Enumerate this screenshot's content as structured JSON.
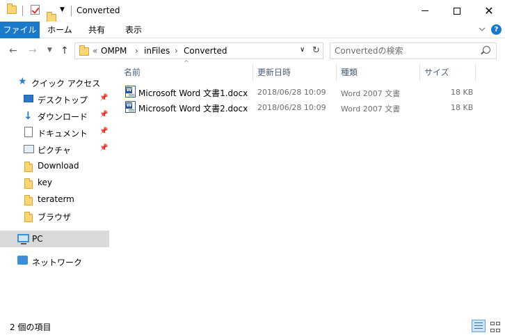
{
  "window": {
    "title": "Converted"
  },
  "ribbon": {
    "tabs": [
      "ファイル",
      "ホーム",
      "共有",
      "表示"
    ],
    "help": "?"
  },
  "address": {
    "overflow": "«",
    "crumbs": [
      "OMPM",
      "inFiles",
      "Converted"
    ],
    "separator": "›"
  },
  "search": {
    "placeholder": "Convertedの検索"
  },
  "navigation": {
    "quick_access": "クイック アクセス",
    "items": [
      {
        "label": "デスクトップ",
        "icon": "desktop-icon",
        "pinned": true
      },
      {
        "label": "ダウンロード",
        "icon": "download-arrow-icon",
        "pinned": true
      },
      {
        "label": "ドキュメント",
        "icon": "documents-icon",
        "pinned": true
      },
      {
        "label": "ピクチャ",
        "icon": "pictures-icon",
        "pinned": true
      },
      {
        "label": "Download",
        "icon": "folder-icon",
        "pinned": false
      },
      {
        "label": "key",
        "icon": "folder-icon",
        "pinned": false
      },
      {
        "label": "teraterm",
        "icon": "folder-icon",
        "pinned": false
      },
      {
        "label": "ブラウザ",
        "icon": "folder-icon",
        "pinned": false
      }
    ],
    "pc": "PC",
    "network": "ネットワーク"
  },
  "columns": [
    "名前",
    "更新日時",
    "種類",
    "サイズ"
  ],
  "files": [
    {
      "name": "Microsoft Word 文書1.docx",
      "modified": "2018/06/28 10:09",
      "type": "Word 2007 文書",
      "size": "18 KB"
    },
    {
      "name": "Microsoft Word 文書2.docx",
      "modified": "2018/06/28 10:09",
      "type": "Word 2007 文書",
      "size": "18 KB"
    }
  ],
  "status": {
    "item_count": "2 個の項目"
  },
  "colors": {
    "accent": "#1979ca",
    "selected_nav": "#d9d9d9",
    "header_text": "#4c607a"
  }
}
